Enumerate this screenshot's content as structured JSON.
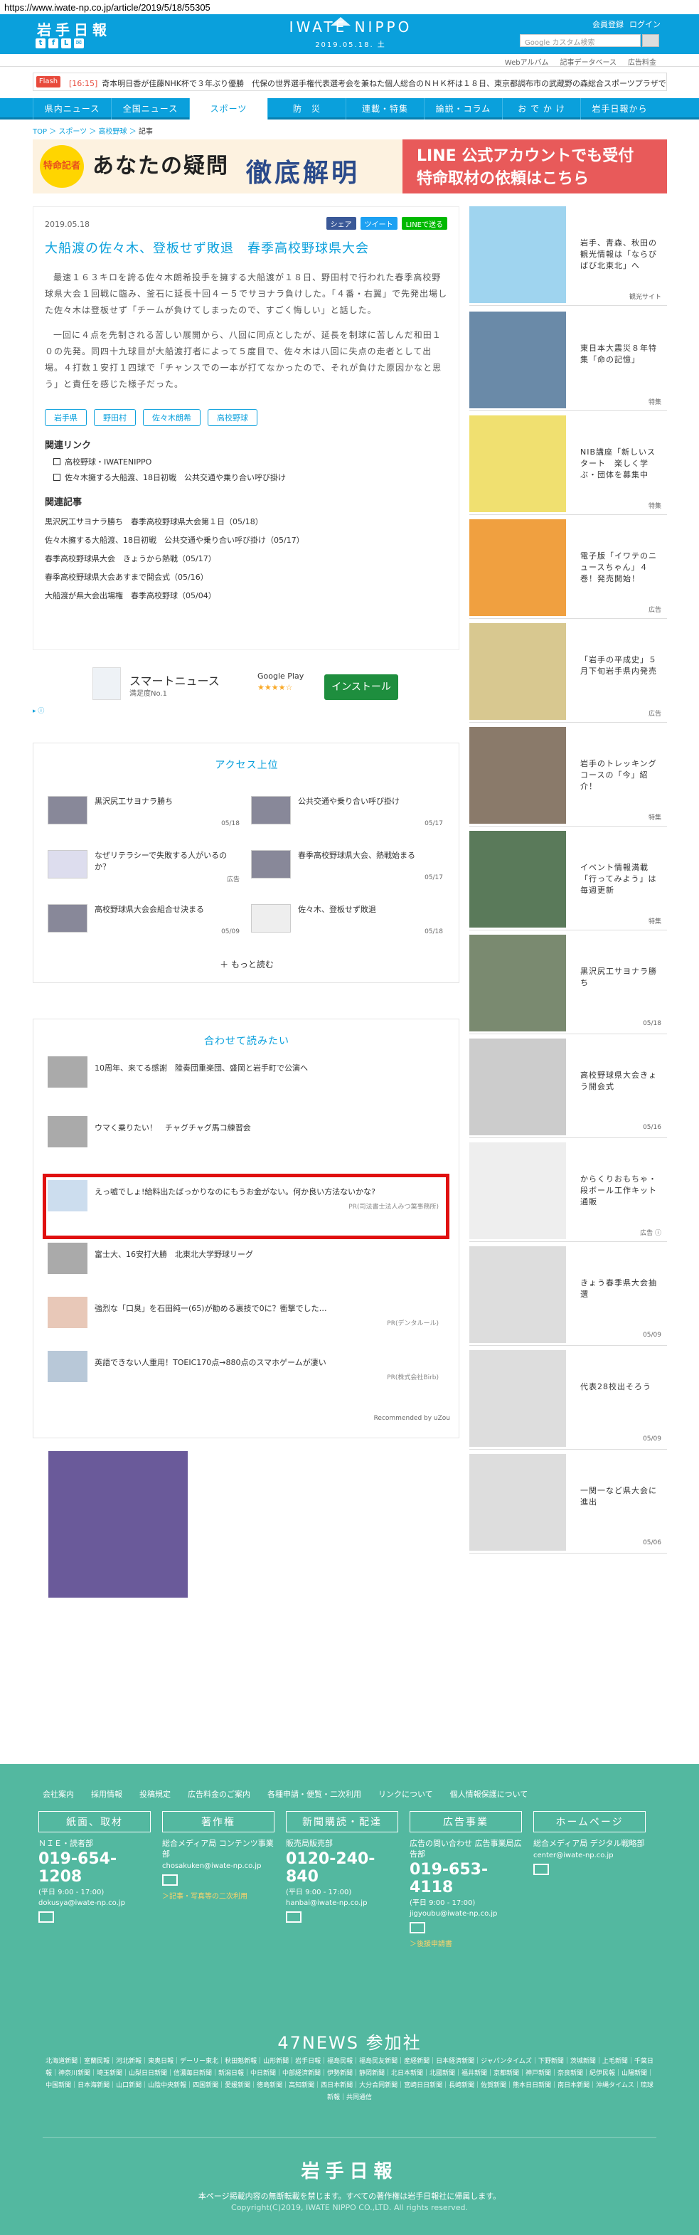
{
  "url": "https://www.iwate-np.co.jp/article/2019/5/18/55305",
  "header": {
    "logo": "岩手日報",
    "site": "IWATE NIPPO",
    "date": "2019.05.18. 土",
    "links": [
      "会員登録",
      "ログイン"
    ],
    "search_placeholder": "Google カスタム検索"
  },
  "subbar": [
    "Webアルバム",
    "記事データベース",
    "広告料金"
  ],
  "flash": {
    "label": "Flash",
    "time": "[16:15]",
    "text": "奇本明日香が佳藤NHK杯で３年ぶり優勝　代保の世界選手権代表選考会を兼ねた個人総合のＮＨＫ杯は１８日、東京都調布市の武蔵野の森総合スポーツプラザで"
  },
  "nav": [
    "県内ニュース",
    "全国ニュース",
    "スポーツ",
    "防　災",
    "連載・特集",
    "論説・コラム",
    "お で か け",
    "岩手日報から"
  ],
  "breadcrumb": [
    "TOP",
    "スポーツ",
    "高校野球",
    "記事"
  ],
  "banner": {
    "badge": "特命記者",
    "text1": "あなたの疑問",
    "text2": "徹底解明",
    "right1": "LINE 公式アカウントでも受付",
    "right2": "特命取材の依頼はこちら"
  },
  "article": {
    "date": "2019.05.18",
    "share": [
      "シェア",
      "ツイート",
      "LINEで送る"
    ],
    "title": "大船渡の佐々木、登板せず敗退　春季高校野球県大会",
    "body": [
      "最速１６３キロを誇る佐々木朗希投手を擁する大船渡が１８日、野田村で行われた春季高校野球県大会１回戦に臨み、釜石に延長十回４－５でサヨナラ負けした。「４番・右翼」で先発出場した佐々木は登板せず「チームが負けてしまったので、すごく悔しい」と話した。",
      "一回に４点を先制される苦しい展開から、八回に同点としたが、延長を制球に苦しんだ和田１０の先発。同四十九球目が大船渡打者によって５度目で、佐々木は八回に失点の走者として出場。４打数１安打１四球で「チャンスでの一本が打てなかったので、それが負けた原因かなと思う」と責任を感じた様子だった。"
    ],
    "tags": [
      "岩手県",
      "野田村",
      "佐々木朗希",
      "高校野球"
    ],
    "related_title": "関連リンク",
    "related": [
      "高校野球・IWATENIPPO",
      "佐々木擁する大船渡、18日初戦　公共交通や乗り合い呼び掛け"
    ],
    "news_title": "関連記事",
    "news": [
      "黒沢尻工サヨナラ勝ち　春季高校野球県大会第１日（05/18）",
      "佐々木擁する大船渡、18日初戦　公共交通や乗り合い呼び掛け（05/17）",
      "春季高校野球県大会　きょうから熱戦（05/17）",
      "春季高校野球県大会あすまで開会式（05/16）",
      "大船渡が県大会出場権　春季高校野球（05/04）"
    ]
  },
  "ad": {
    "name": "スマートニュース",
    "sub": "満足度No.1",
    "store": "Google Play",
    "stars": "★★★★☆",
    "button": "インストール",
    "mark": "▸ ⓘ"
  },
  "ranking": {
    "title": "アクセス上位",
    "items": [
      {
        "text": "黒沢尻工サヨナラ勝ち",
        "date": "05/18"
      },
      {
        "text": "公共交通や乗り合い呼び掛け",
        "date": "05/17"
      },
      {
        "text": "なぜリテラシーで失敗する人がいるのか？",
        "date": "広告"
      },
      {
        "text": "春季高校野球県大会、熱戦始まる",
        "date": "05/17"
      },
      {
        "text": "高校野球県大会会組合せ決まる",
        "date": "05/09"
      },
      {
        "text": "佐々木、登板せず敗退",
        "date": "05/18"
      }
    ],
    "more": "もっと読む"
  },
  "recommend": {
    "title": "合わせて読みたい",
    "items": [
      {
        "text": "10周年、来てる感謝　陸奏団重楽団、盛岡と岩手町で公演へ",
        "pr": ""
      },
      {
        "text": "ウマく乗りたい！　チャグチャグ馬コ練習会",
        "pr": ""
      },
      {
        "text": "えっ嘘でしょ!給料出たばっかりなのにもうお金がない。何か良い方法ないかな?",
        "pr": "PR(司法書士法人みつ葉事務所)"
      },
      {
        "text": "富士大、16安打大勝　北東北大学野球リーグ",
        "pr": ""
      },
      {
        "text": "強烈な「口臭」を石田純一(65)が勧める裏技で0に？衝撃でした…",
        "pr": "PR(デンタルール)"
      },
      {
        "text": "英語できない人重用！TOEIC170点→880点のスマホゲームが凄い",
        "pr": "PR(株式会社Birb)"
      }
    ],
    "credit": "Recommended by uZou"
  },
  "side": [
    {
      "text": "岩手、青森、秋田の観光情報は「ならびばび北東北」へ",
      "cat": "観光サイト"
    },
    {
      "text": "東日本大震災８年特集「命の記憶」",
      "cat": "特集"
    },
    {
      "text": "NIB講座「新しいスタート　楽しく学ぶ・団体を募集中",
      "cat": "特集"
    },
    {
      "text": "電子版「イワテのニュースちゃん」４巻！発売開始！",
      "cat": "広告"
    },
    {
      "text": "「岩手の平成史」５月下旬岩手県内発売",
      "cat": "広告"
    },
    {
      "text": "岩手のトレッキングコースの「今」紹介！",
      "cat": "特集"
    },
    {
      "text": "イベント情報満載「行ってみよう」は毎週更新",
      "cat": "特集"
    },
    {
      "text": "黒沢尻工サヨナラ勝ち",
      "cat": "05/18"
    },
    {
      "text": "高校野球県大会きょう開会式",
      "cat": "05/16"
    },
    {
      "text": "からくりおもちゃ・段ボール工作キット通販",
      "cat": "広告 ⓘ"
    },
    {
      "text": "きょう春季県大会抽選",
      "cat": "05/09"
    },
    {
      "text": "代表28校出そろう",
      "cat": "05/09"
    },
    {
      "text": "一関一など県大会に進出",
      "cat": "05/06"
    }
  ],
  "footer": {
    "links": [
      "会社案内",
      "採用情報",
      "投稿規定",
      "広告料金のご案内",
      "各種申請・便覧・二次利用",
      "リンクについて",
      "個人情報保護について"
    ],
    "cols": [
      {
        "head": "紙面、取材",
        "t1": "ＮＩＥ・読者部",
        "phone": "019-654-1208",
        "hours": "(平日 9:00 - 17:00)",
        "mail": "dokusya@iwate-np.co.jp",
        "extra": ""
      },
      {
        "head": "著作権",
        "t1": "総合メディア局 コンテンツ事業部",
        "phone": "",
        "hours": "",
        "mail": "chosakuken@iwate-np.co.jp",
        "extra": "＞記事・写真等の二次利用"
      },
      {
        "head": "新聞購読・配達",
        "t1": "販売局販売部",
        "phone": "0120-240-840",
        "hours": "(平日 9:00 - 17:00)",
        "mail": "hanbai@iwate-np.co.jp",
        "extra": ""
      },
      {
        "head": "広告事業",
        "t1": "広告の問い合わせ 広告事業局広告部",
        "phone": "019-653-4118",
        "hours": "(平日 9:00 - 17:00)",
        "mail": "jigyoubu@iwate-np.co.jp",
        "extra": "＞後援申請書"
      },
      {
        "head": "ホームページ",
        "t1": "総合メディア局 デジタル戦略部",
        "phone": "",
        "hours": "",
        "mail": "center@iwate-np.co.jp",
        "extra": ""
      }
    ],
    "news47": "47NEWS 参加社",
    "papers": "北海道新聞｜室蘭民報｜河北新報｜東奥日報｜デーリー東北｜秋田魁新報｜山形新聞｜岩手日報｜福島民報｜福島民友新聞｜産経新聞｜日本経済新聞｜ジャパンタイムズ｜下野新聞｜茨城新聞｜上毛新聞｜千葉日報｜神奈川新聞｜埼玉新聞｜山梨日日新聞｜信濃毎日新聞｜新潟日報｜中日新聞｜中部経済新聞｜伊勢新聞｜静岡新聞｜北日本新聞｜北國新聞｜福井新聞｜京都新聞｜神戸新聞｜奈良新聞｜紀伊民報｜山陽新聞｜中国新聞｜日本海新聞｜山口新聞｜山陰中央新報｜四国新聞｜愛媛新聞｜徳島新聞｜高知新聞｜西日本新聞｜大分合同新聞｜宮崎日日新聞｜長崎新聞｜佐賀新聞｜熊本日日新聞｜南日本新聞｜沖縄タイムス｜琉球新報｜共同通信",
    "logo": "岩手日報",
    "notice": "本ページ掲載内容の無断転載を禁じます。すべての著作権は岩手日報社に帰属します。",
    "copyright": "Copyright(C)2019, IWATE NIPPO CO.,LTD. All rights reserved."
  }
}
